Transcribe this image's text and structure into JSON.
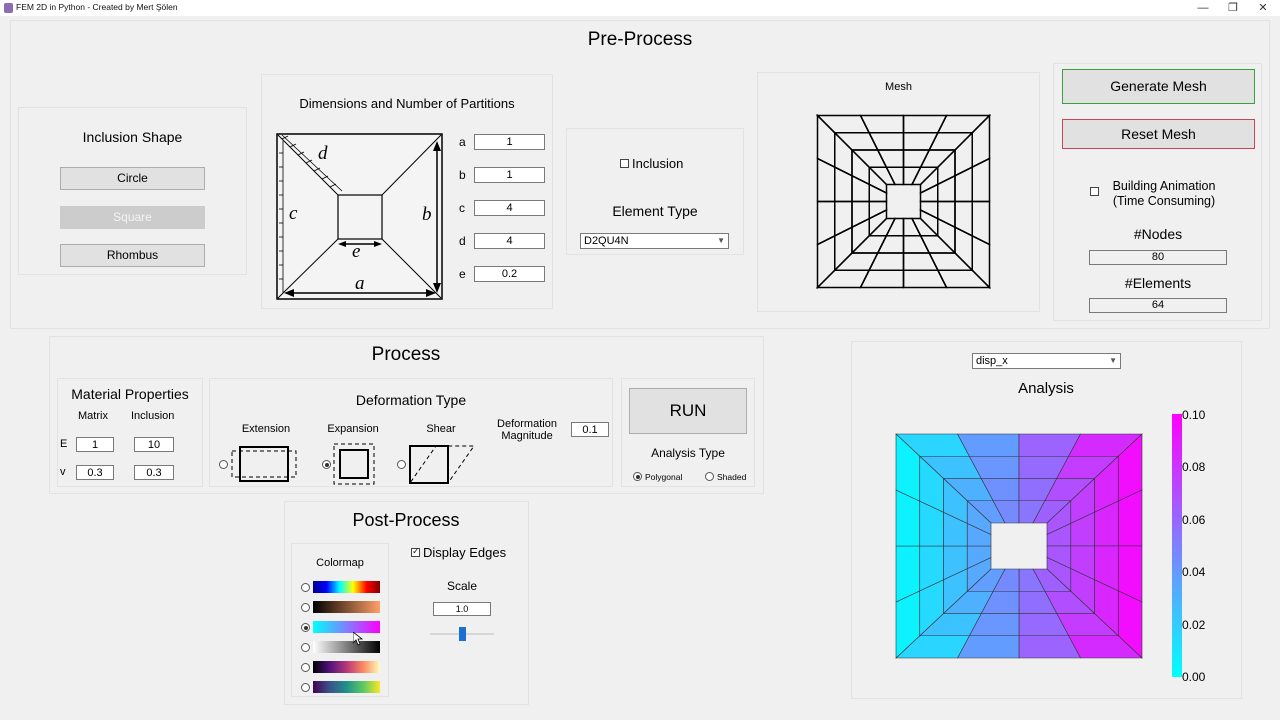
{
  "window": {
    "title": "FEM 2D in Python - Created by Mert Şölen",
    "minimize": "—",
    "restore": "❐",
    "close": "✕"
  },
  "preprocess": {
    "title": "Pre-Process",
    "inclusion_shape": {
      "title": "Inclusion Shape",
      "buttons": [
        "Circle",
        "Square",
        "Rhombus"
      ]
    },
    "dimensions": {
      "title": "Dimensions and Number of Partitions",
      "diagram_labels": {
        "a": "a",
        "b": "b",
        "c": "c",
        "d": "d",
        "e": "e"
      },
      "fields": [
        {
          "label": "a",
          "value": "1"
        },
        {
          "label": "b",
          "value": "1"
        },
        {
          "label": "c",
          "value": "4"
        },
        {
          "label": "d",
          "value": "4"
        },
        {
          "label": "e",
          "value": "0.2"
        }
      ]
    },
    "inclusion_checkbox": "Inclusion",
    "element_type": {
      "title": "Element Type",
      "selected": "D2QU4N"
    },
    "mesh": {
      "title": "Mesh"
    },
    "generate_mesh": "Generate Mesh",
    "reset_mesh": "Reset Mesh",
    "building_animation": "Building Animation",
    "building_animation_note": "(Time Consuming)",
    "nodes_label": "#Nodes",
    "nodes_value": "80",
    "elements_label": "#Elements",
    "elements_value": "64"
  },
  "process": {
    "title": "Process",
    "material": {
      "title": "Material Properties",
      "col_matrix": "Matrix",
      "col_inclusion": "Inclusion",
      "rows": [
        {
          "label": "E",
          "matrix": "1",
          "inclusion": "10"
        },
        {
          "label": "v",
          "matrix": "0.3",
          "inclusion": "0.3"
        }
      ]
    },
    "deformation": {
      "title": "Deformation Type",
      "types": [
        "Extension",
        "Expansion",
        "Shear"
      ],
      "magnitude_label": "Deformation Magnitude",
      "magnitude_value": "0.1"
    },
    "run": "RUN",
    "analysis_type": {
      "title": "Analysis Type",
      "options": [
        "Polygonal",
        "Shaded"
      ]
    }
  },
  "postprocess": {
    "title": "Post-Process",
    "colormap_title": "Colormap",
    "display_edges": "Display Edges",
    "scale_label": "Scale",
    "scale_value": "1.0",
    "slider_level": 0.5
  },
  "analysis": {
    "selected": "disp_x",
    "title": "Analysis",
    "colorbar_ticks": [
      "0.10",
      "0.08",
      "0.06",
      "0.04",
      "0.02",
      "0.00"
    ]
  },
  "colors": {
    "generate_border": "#3ca03c",
    "reset_border": "#c8465a",
    "slider": "#1a6fd0",
    "cool_start": "#00ffff",
    "cool_end": "#ff00ff"
  }
}
